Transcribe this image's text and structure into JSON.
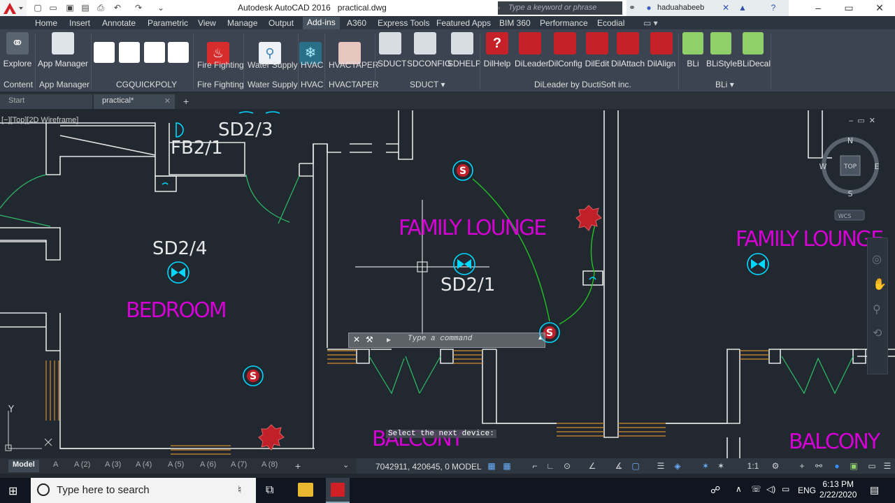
{
  "title_bar": {
    "app_title": "Autodesk AutoCAD 2016",
    "file_name": "practical.dwg",
    "search_placeholder": "Type a keyword or phrase",
    "username": "haduahabeeb"
  },
  "menu_tabs": [
    "Home",
    "Insert",
    "Annotate",
    "Parametric",
    "View",
    "Manage",
    "Output",
    "Add-ins",
    "A360",
    "Express Tools",
    "Featured Apps",
    "BIM 360",
    "Performance",
    "Ecodial"
  ],
  "active_menu": "Add-ins",
  "ribbon": {
    "buttons": [
      "Explore",
      "App Manager",
      "Fire Fighting",
      "Water Supply",
      "HVAC",
      "HVACTAPER",
      "SDUCT",
      "SDCONFIG",
      "SDHELP",
      "DilHelp",
      "DiLeader",
      "DilConfig",
      "DilEdit",
      "DilAttach",
      "DilAlign",
      "BLi",
      "BLiStyle",
      "BLiDecal"
    ],
    "panels": [
      "Content",
      "App Manager",
      "CGQUICKPOLY",
      "Fire Fighting",
      "Water Supply",
      "HVAC",
      "HVACTAPER",
      "SDUCT",
      "DiLeader by DuctiSoft inc.",
      "BLi"
    ]
  },
  "file_tabs": [
    "Start",
    "practical*"
  ],
  "viewport": {
    "label": "[−][Top][2D Wireframe]",
    "rooms": [
      "FAMILY LOUNGE",
      "FAMILY LOUNGE",
      "BEDROOM",
      "BALCONY",
      "BALCONY"
    ],
    "tags": [
      "SD2/3",
      "FB2/1",
      "SD2/4",
      "SD2/1"
    ],
    "symbol_text": [
      "S",
      "S",
      "S"
    ],
    "viewcube": {
      "n": "N",
      "s": "S",
      "e": "E",
      "w": "W",
      "top": "TOP",
      "wcs": "WCS"
    },
    "ucs": {
      "y": "Y"
    }
  },
  "command": {
    "prompt": "Select the next device:",
    "placeholder": "Type a command"
  },
  "layout_tabs": [
    "Model",
    "A",
    "A (2)",
    "A (3)",
    "A (4)",
    "A (5)",
    "A (6)",
    "A (7)",
    "A (8)"
  ],
  "status_bar": {
    "coords": "7042911, 420645, 0",
    "model": "MODEL",
    "scale": "1:1"
  },
  "taskbar": {
    "search_placeholder": "Type here to search",
    "time": "6:13 PM",
    "date": "2/22/2020",
    "lang": "ENG"
  },
  "colors": {
    "room_text": "#d400d4",
    "symbol": "#00d8ff",
    "leader": "#22c422",
    "wall": "#e6e6e6",
    "window": "#d78a2a",
    "device_red": "#c0202a"
  }
}
